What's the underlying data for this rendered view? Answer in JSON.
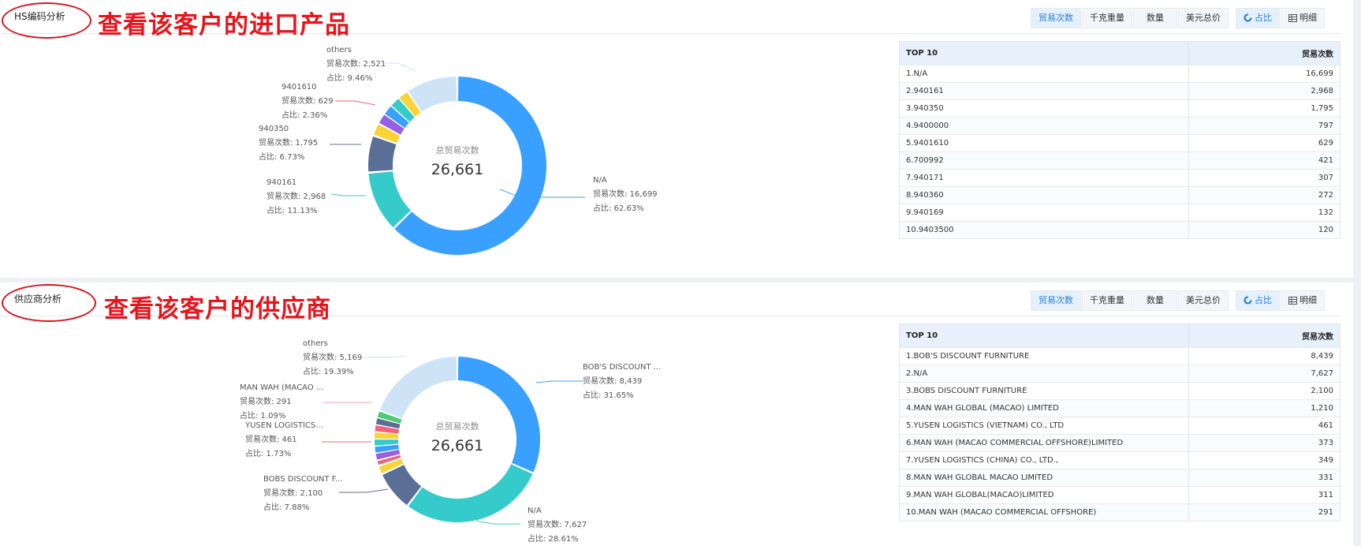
{
  "sections": [
    {
      "title": "HS编码分析",
      "annotation": "查看该客户的进口产品",
      "toolbar": {
        "buttons": [
          "贸易次数",
          "千克重量",
          "数量",
          "美元总价"
        ],
        "active": "贸易次数",
        "view_ratio": "占比",
        "view_detail": "明细"
      },
      "chart": {
        "center_label": "总贸易次数",
        "center_value": "26,661",
        "labels": [
          {
            "name": "N/A",
            "count_line": "贸易次数: 16,699",
            "pct_line": "占比: 62.63%"
          },
          {
            "name": "940161",
            "count_line": "贸易次数: 2,968",
            "pct_line": "占比: 11.13%"
          },
          {
            "name": "940350",
            "count_line": "贸易次数: 1,795",
            "pct_line": "占比: 6.73%"
          },
          {
            "name": "9401610",
            "count_line": "贸易次数: 629",
            "pct_line": "占比: 2.36%"
          },
          {
            "name": "others",
            "count_line": "贸易次数: 2,521",
            "pct_line": "占比: 9.46%"
          }
        ]
      },
      "table": {
        "header_name": "TOP 10",
        "header_value": "贸易次数",
        "rows": [
          {
            "name": "1.N/A",
            "value": "16,699"
          },
          {
            "name": "2.940161",
            "value": "2,968"
          },
          {
            "name": "3.940350",
            "value": "1,795"
          },
          {
            "name": "4.9400000",
            "value": "797"
          },
          {
            "name": "5.9401610",
            "value": "629"
          },
          {
            "name": "6.700992",
            "value": "421"
          },
          {
            "name": "7.940171",
            "value": "307"
          },
          {
            "name": "8.940360",
            "value": "272"
          },
          {
            "name": "9.940169",
            "value": "132"
          },
          {
            "name": "10.9403500",
            "value": "120"
          }
        ]
      }
    },
    {
      "title": "供应商分析",
      "annotation": "查看该客户的供应商",
      "toolbar": {
        "buttons": [
          "贸易次数",
          "千克重量",
          "数量",
          "美元总价"
        ],
        "active": "贸易次数",
        "view_ratio": "占比",
        "view_detail": "明细"
      },
      "chart": {
        "center_label": "总贸易次数",
        "center_value": "26,661",
        "labels": [
          {
            "name": "BOB'S DISCOUNT ...",
            "count_line": "贸易次数: 8,439",
            "pct_line": "占比: 31.65%"
          },
          {
            "name": "N/A",
            "count_line": "贸易次数: 7,627",
            "pct_line": "占比: 28.61%"
          },
          {
            "name": "BOBS DISCOUNT F...",
            "count_line": "贸易次数: 2,100",
            "pct_line": "占比: 7.88%"
          },
          {
            "name": "YUSEN LOGISTICS...",
            "count_line": "贸易次数: 461",
            "pct_line": "占比: 1.73%"
          },
          {
            "name": "MAN WAH (MACAO ...",
            "count_line": "贸易次数: 291",
            "pct_line": "占比: 1.09%"
          },
          {
            "name": "others",
            "count_line": "贸易次数: 5,169",
            "pct_line": "占比: 19.39%"
          }
        ]
      },
      "table": {
        "header_name": "TOP 10",
        "header_value": "贸易次数",
        "rows": [
          {
            "name": "1.BOB'S DISCOUNT FURNITURE",
            "value": "8,439"
          },
          {
            "name": "2.N/A",
            "value": "7,627"
          },
          {
            "name": "3.BOBS DISCOUNT FURNITURE",
            "value": "2,100"
          },
          {
            "name": "4.MAN WAH GLOBAL (MACAO) LIMITED",
            "value": "1,210"
          },
          {
            "name": "5.YUSEN LOGISTICS (VIETNAM) CO., LTD",
            "value": "461"
          },
          {
            "name": "6.MAN WAH (MACAO COMMERCIAL OFFSHORE)LIMITED",
            "value": "373"
          },
          {
            "name": "7.YUSEN LOGISTICS (CHINA) CO., LTD.,",
            "value": "349"
          },
          {
            "name": "8.MAN WAH GLOBAL MACAO LIMITED",
            "value": "331"
          },
          {
            "name": "9.MAN WAH GLOBAL(MACAO)LIMITED",
            "value": "311"
          },
          {
            "name": "10.MAN WAH (MACAO COMMERCIAL OFFSHORE)",
            "value": "291"
          }
        ]
      }
    }
  ],
  "colors": {
    "blue": "#3aa0ff",
    "teal": "#36cbcb",
    "slate": "#5b6e96",
    "yellow": "#fad337",
    "pink": "#f2637b",
    "purple": "#975fe4",
    "light": "#cfe3f7",
    "annotation_red": "#e8141b"
  },
  "chart_data": [
    {
      "type": "pie",
      "categories": [
        "N/A",
        "940161",
        "940350",
        "9401610",
        "others"
      ],
      "values": [
        16699,
        2968,
        1795,
        629,
        2521
      ],
      "total": 26661
    },
    {
      "type": "pie",
      "categories": [
        "BOB'S DISCOUNT FURNITURE",
        "N/A",
        "BOBS DISCOUNT FURNITURE",
        "YUSEN LOGISTICS",
        "MAN WAH (MACAO",
        "others"
      ],
      "values": [
        8439,
        7627,
        2100,
        461,
        291,
        5169
      ],
      "total": 26661
    }
  ]
}
